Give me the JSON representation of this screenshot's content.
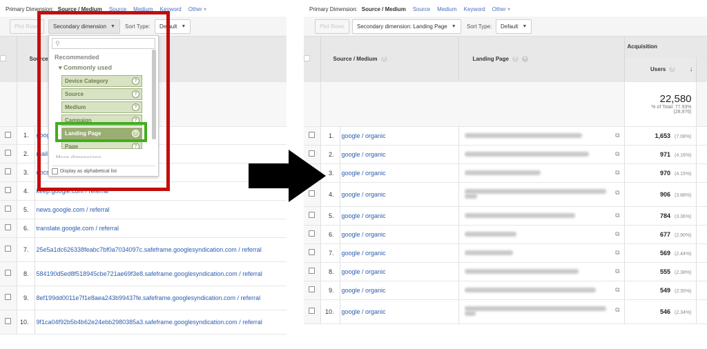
{
  "left": {
    "primary_dimension": {
      "label": "Primary Dimension:",
      "current": "Source / Medium",
      "options": [
        "Source",
        "Medium",
        "Keyword",
        "Other"
      ]
    },
    "toolbar": {
      "plot_rows": "Plot Rows",
      "secondary_dimension": "Secondary dimension",
      "sort_type_label": "Sort Type:",
      "sort_type_value": "Default"
    },
    "table_header": {
      "source_medium": "Source / Medium"
    },
    "dropdown": {
      "search_placeholder": "",
      "recommended": "Recommended",
      "commonly_used": "Commonly used",
      "items": [
        "Device Category",
        "Source",
        "Medium",
        "Campaign",
        "Landing Page",
        "Page"
      ],
      "selected": "Landing Page",
      "more_dimensions": "More dimensions",
      "alphabetical_label": "Display as alphabetical list"
    },
    "rows": [
      {
        "n": "1.",
        "source": "google / organic"
      },
      {
        "n": "2.",
        "source": "mail.google.com / referral"
      },
      {
        "n": "3.",
        "source": "docs.google.com / referral"
      },
      {
        "n": "4.",
        "source": "keep.google.com / referral"
      },
      {
        "n": "5.",
        "source": "news.google.com / referral"
      },
      {
        "n": "6.",
        "source": "translate.google.com / referral"
      },
      {
        "n": "7.",
        "source": "25e5a1dc626338feabc7bf0a7034097c.safeframe.googlesyndication.com / referral"
      },
      {
        "n": "8.",
        "source": "584190d5ed8f518945cbe721ae69f3e8.safeframe.googlesyndication.com / referral"
      },
      {
        "n": "9.",
        "source": "8ef199dd0011e7f1e8aea243b99437fe.safeframe.googlesyndication.com / referral"
      },
      {
        "n": "10.",
        "source": "9f1ca04f92b5b4b62e24ebb2980385a3.safeframe.googlesyndication.com / referral"
      }
    ]
  },
  "right": {
    "primary_dimension": {
      "label": "Primary Dimension:",
      "current": "Source / Medium",
      "options": [
        "Source",
        "Medium",
        "Keyword",
        "Other"
      ]
    },
    "toolbar": {
      "plot_rows": "Plot Rows",
      "secondary_dimension": "Secondary dimension: Landing Page",
      "sort_type_label": "Sort Type:",
      "sort_type_value": "Default"
    },
    "table_header": {
      "source_medium": "Source / Medium",
      "landing_page": "Landing Page",
      "group": "Acquisition",
      "users": "Users"
    },
    "totals": {
      "users": "22,580",
      "pct_of_total": "% of Total: 77.93%",
      "grand_total": "(28,976)"
    },
    "rows": [
      {
        "n": "1.",
        "source": "google / organic",
        "users": "1,653",
        "pct": "(7.08%)"
      },
      {
        "n": "2.",
        "source": "google / organic",
        "users": "971",
        "pct": "(4.16%)"
      },
      {
        "n": "3.",
        "source": "google / organic",
        "users": "970",
        "pct": "(4.15%)"
      },
      {
        "n": "4.",
        "source": "google / organic",
        "users": "906",
        "pct": "(3.88%)"
      },
      {
        "n": "5.",
        "source": "google / organic",
        "users": "784",
        "pct": "(3.36%)"
      },
      {
        "n": "6.",
        "source": "google / organic",
        "users": "677",
        "pct": "(2.90%)"
      },
      {
        "n": "7.",
        "source": "google / organic",
        "users": "569",
        "pct": "(2.44%)"
      },
      {
        "n": "8.",
        "source": "google / organic",
        "users": "555",
        "pct": "(2.38%)"
      },
      {
        "n": "9.",
        "source": "google / organic",
        "users": "549",
        "pct": "(2.35%)"
      },
      {
        "n": "10.",
        "source": "google / organic",
        "users": "546",
        "pct": "(2.34%)"
      }
    ]
  },
  "annotations": {
    "highlight_box_color": "#c40d0d",
    "selected_item_box_color": "#3fae1c",
    "arrow_color": "#000000"
  }
}
